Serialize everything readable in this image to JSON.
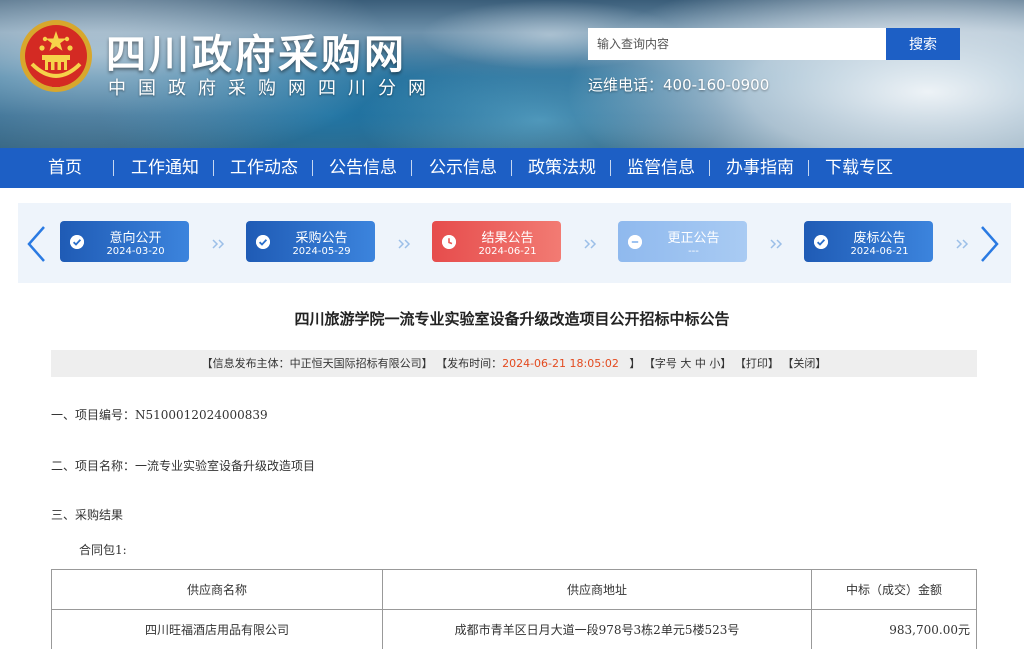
{
  "header": {
    "site_title": "四川政府采购网",
    "site_subtitle": "中国政府采购网四川分网",
    "search_placeholder": "输入查询内容",
    "search_button": "搜索",
    "hotline": "运维电话：400-160-0900"
  },
  "nav": {
    "items": [
      {
        "label": "首页"
      },
      {
        "label": "工作通知"
      },
      {
        "label": "工作动态"
      },
      {
        "label": "公告信息"
      },
      {
        "label": "公示信息"
      },
      {
        "label": "政策法规"
      },
      {
        "label": "监管信息"
      },
      {
        "label": "办事指南"
      },
      {
        "label": "下载专区"
      }
    ],
    "separator": "|"
  },
  "timeline": {
    "steps": [
      {
        "label": "意向公开",
        "date": "2024-03-20",
        "status": "done",
        "icon": "check-circle-icon"
      },
      {
        "label": "采购公告",
        "date": "2024-05-29",
        "status": "done",
        "icon": "check-circle-icon"
      },
      {
        "label": "结果公告",
        "date": "2024-06-21",
        "status": "current",
        "icon": "clock-icon"
      },
      {
        "label": "更正公告",
        "date": "---",
        "status": "none",
        "icon": "minus-circle-icon"
      },
      {
        "label": "废标公告",
        "date": "2024-06-21",
        "status": "done",
        "icon": "check-circle-icon"
      }
    ],
    "colors": {
      "done": "#2a6fcb",
      "current": "#eb5a55",
      "none": "#9ec3f1"
    }
  },
  "article": {
    "title": "四川旅游学院一流专业实验室设备升级改造项目公开招标中标公告",
    "info": {
      "publisher": "【信息发布主体：中正恒天国际招标有限公司】",
      "time_label": "【发布时间：",
      "time_value": "2024-06-21 18:05:02",
      "time_close": "】",
      "font_size_label": "【字号",
      "font_large": "大",
      "font_medium": "中",
      "font_small": "小",
      "font_close": "】",
      "print": "【打印】",
      "close": "【关闭】"
    },
    "project_no": "一、项目编号：N5100012024000839",
    "project_name": "二、项目名称：一流专业实验室设备升级改造项目",
    "result_heading": "三、采购结果",
    "package_label": "合同包1:"
  },
  "result_table": {
    "headers": [
      "供应商名称",
      "供应商地址",
      "中标（成交）金额"
    ],
    "rows": [
      [
        "四川旺福酒店用品有限公司",
        "成都市青羊区日月大道一段978号3栋2单元5楼523号",
        "983,700.00元"
      ]
    ]
  },
  "colors": {
    "nav_bg": "#1d5fc5",
    "highlight_red": "#e34a1f"
  }
}
